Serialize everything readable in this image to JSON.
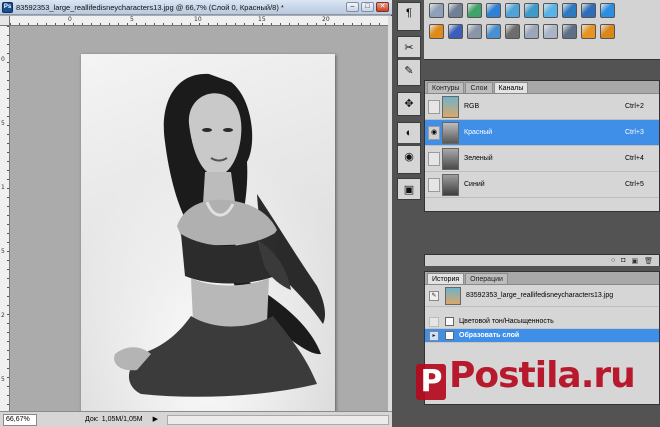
{
  "document": {
    "title": "83592353_large_reallifedisneycharacters13.jpg @ 66,7% (Слой 0, Красный/8) *",
    "zoom": "66,67%",
    "doc_size_label": "Док:",
    "doc_size_value": "1,05M/1,05M",
    "ruler_ticks": [
      "0",
      "5",
      "10",
      "15",
      "20"
    ],
    "ruler_left_ticks": [
      "0",
      "5",
      "1",
      "5",
      "2",
      "5"
    ]
  },
  "window_controls": {
    "minimize": "–",
    "restore": "□",
    "close": "✕"
  },
  "tools": [
    {
      "name": "paragraph-icon",
      "glyph": "¶"
    },
    {
      "name": "scissors-icon",
      "glyph": "✂"
    },
    {
      "name": "tool-icon-3",
      "glyph": "✎"
    },
    {
      "name": "tool-icon-4",
      "glyph": "✥"
    },
    {
      "name": "tool-icon-5",
      "glyph": "◐"
    },
    {
      "name": "tool-icon-6",
      "glyph": "◉"
    },
    {
      "name": "tool-icon-7",
      "glyph": "▣"
    }
  ],
  "styles_panel": {
    "row1_colors": [
      "#8ea0b8",
      "#6f7f96",
      "#3fa36a",
      "#2f7fd6",
      "#4fa3d8",
      "#3d9ac9",
      "#58b4e6",
      "#2d7ac0",
      "#2e6db8",
      "#2a8fe0"
    ],
    "row2_colors": [
      "#e08a1a",
      "#3b5fb8",
      "#8a96a8",
      "#4a90d0",
      "#6d6d6d",
      "#9aa7b8",
      "#a9b5c7",
      "#5f6f85",
      "#e89420",
      "#d9871a"
    ]
  },
  "channels_panel": {
    "tabs": [
      {
        "label": "Контуры",
        "active": false
      },
      {
        "label": "Слои",
        "active": false
      },
      {
        "label": "Каналы",
        "active": true
      }
    ],
    "rows": [
      {
        "name": "RGB",
        "shortcut": "Ctrl+2",
        "selected": false,
        "visible": false
      },
      {
        "name": "Красный",
        "shortcut": "Ctrl+3",
        "selected": true,
        "visible": true
      },
      {
        "name": "Зеленый",
        "shortcut": "Ctrl+4",
        "selected": false,
        "visible": false
      },
      {
        "name": "Синий",
        "shortcut": "Ctrl+5",
        "selected": false,
        "visible": false
      }
    ]
  },
  "history_panel": {
    "tabs": [
      {
        "label": "История",
        "active": true
      },
      {
        "label": "Операции",
        "active": false
      }
    ],
    "snapshot": "83592353_large_reallifedisneycharacters13.jpg",
    "steps": [
      {
        "label": "Цветовой тон/Насыщенность",
        "selected": false
      },
      {
        "label": "Образовать слой",
        "selected": true
      }
    ]
  },
  "watermark": {
    "logo_letter": "P",
    "text": "Postila.ru"
  }
}
